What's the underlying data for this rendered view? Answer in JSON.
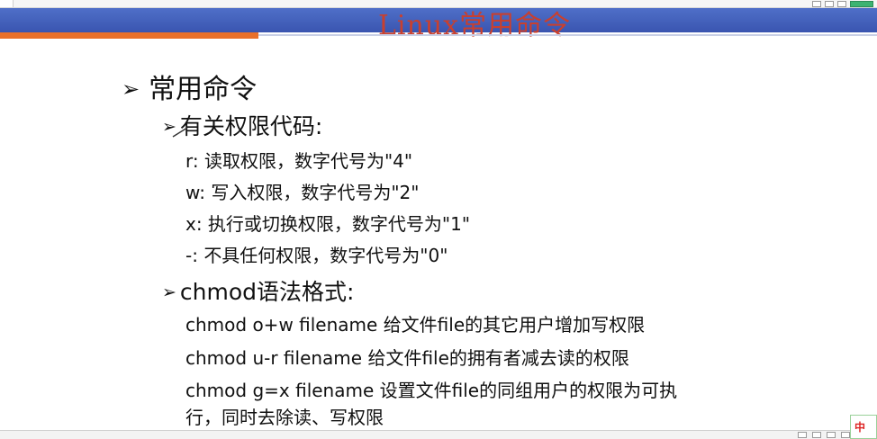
{
  "slide": {
    "title": "Linux常用命令",
    "heading": "常用命令",
    "section_permissions": {
      "title": "有关权限代码:",
      "lines": [
        "r:  读取权限，数字代号为\"4\"",
        "w:  写入权限，数字代号为\"2\"",
        "x:  执行或切换权限，数字代号为\"1\"",
        "-:  不具任何权限，数字代号为\"0\""
      ]
    },
    "section_chmod": {
      "title": "chmod语法格式:",
      "lines": [
        "chmod o+w filename 给文件file的其它用户增加写权限",
        "chmod u-r filename   给文件file的拥有者减去读的权限",
        "chmod g=x filename 设置文件file的同组用户的权限为可执",
        "行，同时去除读、写权限"
      ]
    }
  },
  "ime": {
    "label": "中"
  },
  "colors": {
    "band": "#3f5db8",
    "accent_orange": "#e9702a",
    "title_red": "#c8402f"
  }
}
